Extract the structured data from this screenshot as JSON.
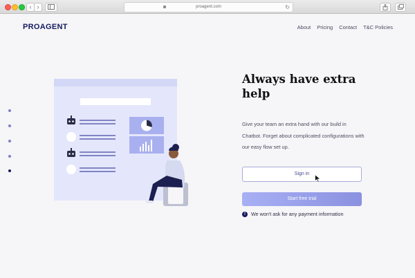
{
  "browser": {
    "url": "proagent.com",
    "reload_glyph": "↻",
    "nav_back": "‹",
    "nav_forward": "›"
  },
  "header": {
    "logo": "PROAGENT",
    "nav": [
      "About",
      "Pricing",
      "Contact",
      "T&C Policies"
    ]
  },
  "hero": {
    "title": "Always have extra help",
    "description": "Give your team an extra hand with our build in Chatbot. Forget about complicated configurations with our easy flow set up.",
    "signin_label": "Sign in",
    "trial_label": "Start free trial",
    "note": "We won't ask for any payment information",
    "note_icon": "!"
  },
  "pagination": {
    "count": 5,
    "active_index": 4
  },
  "colors": {
    "brand": "#151a5e",
    "accent": "#8a91e0",
    "page_bg": "#f6f5f8"
  },
  "icons": [
    "lock-icon",
    "reload-icon",
    "share-icon",
    "tabs-icon",
    "sidebar-icon",
    "info-icon",
    "cursor-icon"
  ]
}
